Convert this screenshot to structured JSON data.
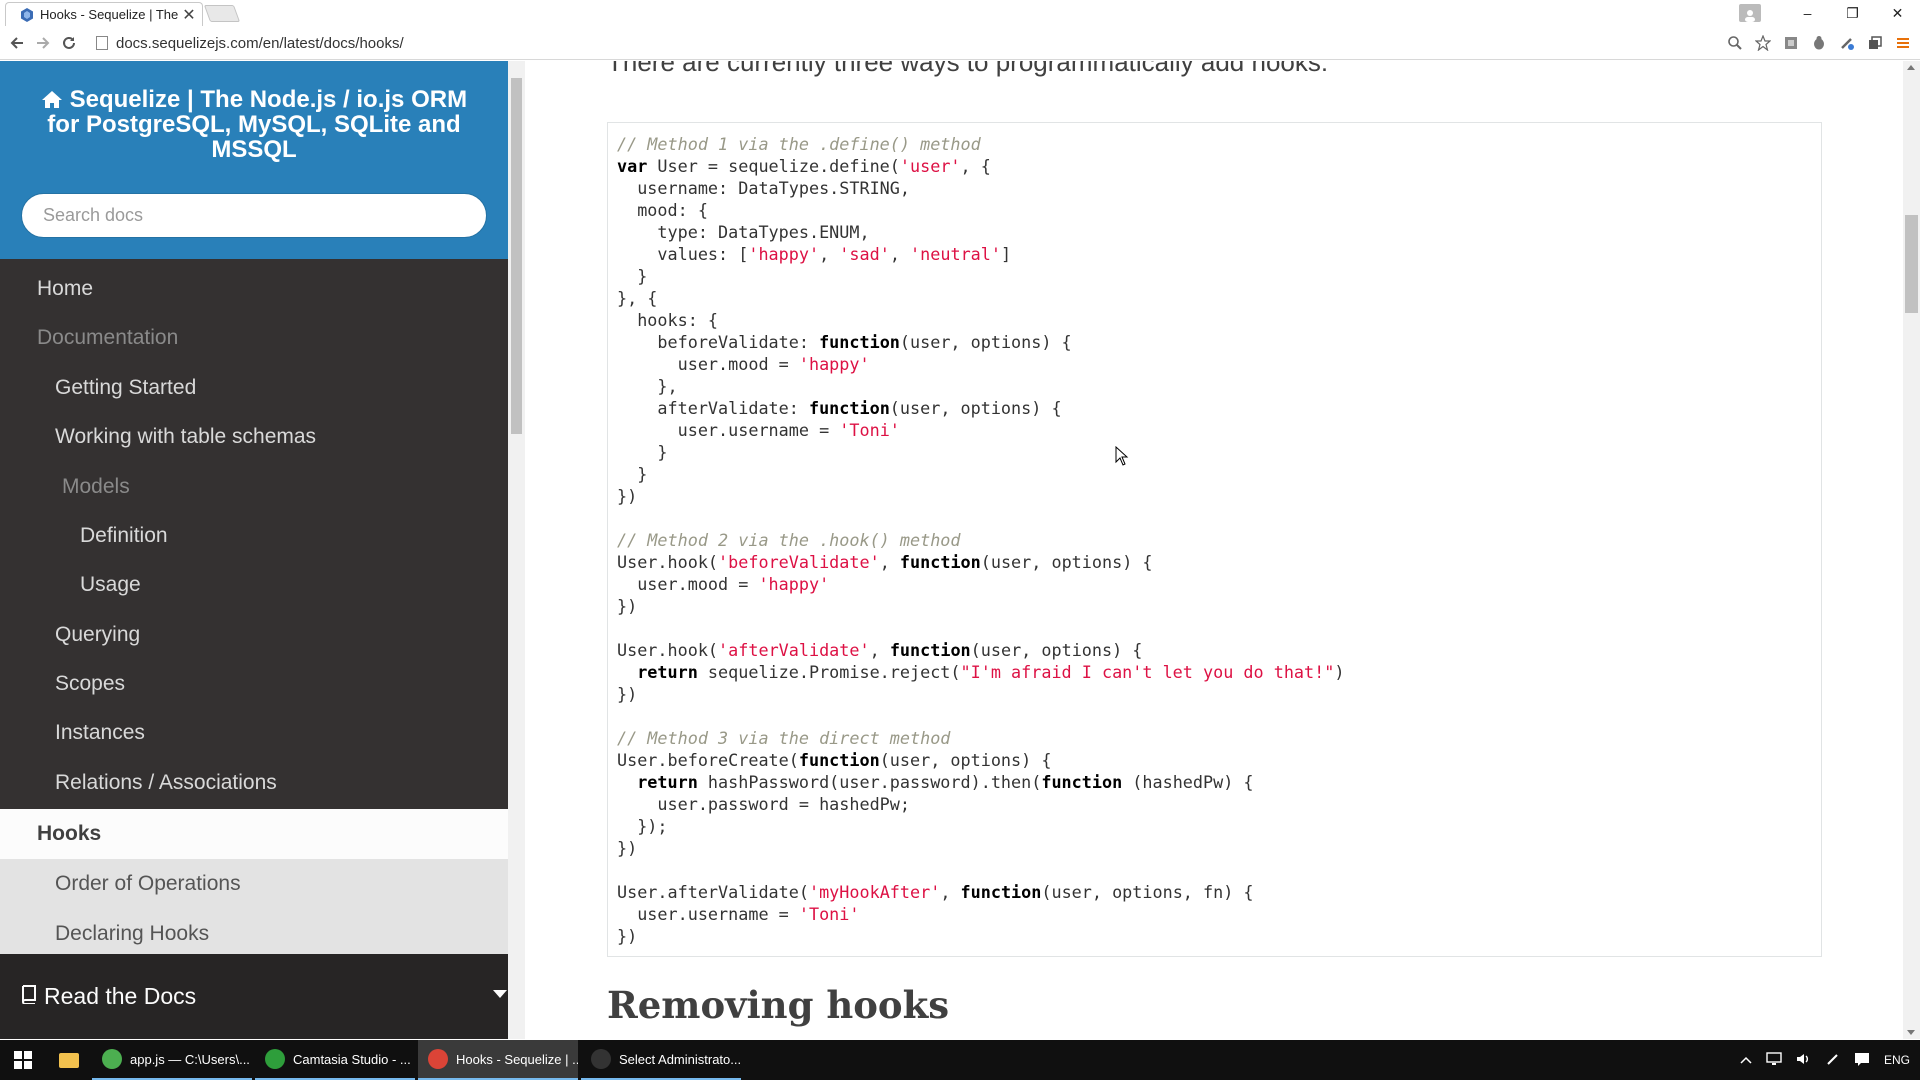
{
  "browser": {
    "tab_title": "Hooks - Sequelize | The N",
    "tab_close": "✕",
    "url": "docs.sequelizejs.com/en/latest/docs/hooks/",
    "window_controls": {
      "minimize": "–",
      "restore": "❐",
      "close": "✕"
    }
  },
  "sidebar": {
    "title": "Sequelize | The Node.js / io.js ORM for PostgreSQL, MySQL, SQLite and MSSQL",
    "search_placeholder": "Search docs",
    "items": [
      {
        "label": "Home"
      },
      {
        "label": "Documentation"
      },
      {
        "label": "Getting Started"
      },
      {
        "label": "Working with table schemas"
      },
      {
        "label": "Models"
      },
      {
        "label": "Definition"
      },
      {
        "label": "Usage"
      },
      {
        "label": "Querying"
      },
      {
        "label": "Scopes"
      },
      {
        "label": "Instances"
      },
      {
        "label": "Relations / Associations"
      },
      {
        "label": "Hooks"
      },
      {
        "label": "Order of Operations"
      },
      {
        "label": "Declaring Hooks"
      }
    ],
    "read_the_docs": "Read the Docs"
  },
  "content": {
    "intro_text": "There are currently three ways to programmatically add hooks:",
    "code_lines": [
      [
        [
          "c",
          "// Method 1 via the .define() method"
        ]
      ],
      [
        [
          "k",
          "var"
        ],
        [
          "t",
          " User = sequelize.define("
        ],
        [
          "s",
          "'user'"
        ],
        [
          "t",
          ", {"
        ]
      ],
      [
        [
          "t",
          "  username: DataTypes.STRING,"
        ]
      ],
      [
        [
          "t",
          "  mood: {"
        ]
      ],
      [
        [
          "t",
          "    type: DataTypes.ENUM,"
        ]
      ],
      [
        [
          "t",
          "    values: ["
        ],
        [
          "s",
          "'happy'"
        ],
        [
          "t",
          ", "
        ],
        [
          "s",
          "'sad'"
        ],
        [
          "t",
          ", "
        ],
        [
          "s",
          "'neutral'"
        ],
        [
          "t",
          "]"
        ]
      ],
      [
        [
          "t",
          "  }"
        ]
      ],
      [
        [
          "t",
          "}, {"
        ]
      ],
      [
        [
          "t",
          "  hooks: {"
        ]
      ],
      [
        [
          "t",
          "    beforeValidate: "
        ],
        [
          "k",
          "function"
        ],
        [
          "t",
          "(user, options) {"
        ]
      ],
      [
        [
          "t",
          "      user.mood = "
        ],
        [
          "s",
          "'happy'"
        ]
      ],
      [
        [
          "t",
          "    },"
        ]
      ],
      [
        [
          "t",
          "    afterValidate: "
        ],
        [
          "k",
          "function"
        ],
        [
          "t",
          "(user, options) {"
        ]
      ],
      [
        [
          "t",
          "      user.username = "
        ],
        [
          "s",
          "'Toni'"
        ]
      ],
      [
        [
          "t",
          "    }"
        ]
      ],
      [
        [
          "t",
          "  }"
        ]
      ],
      [
        [
          "t",
          "})"
        ]
      ],
      [
        [
          "t",
          ""
        ]
      ],
      [
        [
          "c",
          "// Method 2 via the .hook() method"
        ]
      ],
      [
        [
          "t",
          "User.hook("
        ],
        [
          "s",
          "'beforeValidate'"
        ],
        [
          "t",
          ", "
        ],
        [
          "k",
          "function"
        ],
        [
          "t",
          "(user, options) {"
        ]
      ],
      [
        [
          "t",
          "  user.mood = "
        ],
        [
          "s",
          "'happy'"
        ]
      ],
      [
        [
          "t",
          "})"
        ]
      ],
      [
        [
          "t",
          ""
        ]
      ],
      [
        [
          "t",
          "User.hook("
        ],
        [
          "s",
          "'afterValidate'"
        ],
        [
          "t",
          ", "
        ],
        [
          "k",
          "function"
        ],
        [
          "t",
          "(user, options) {"
        ]
      ],
      [
        [
          "k",
          "  return"
        ],
        [
          "t",
          " sequelize.Promise.reject("
        ],
        [
          "s",
          "\"I'm afraid I can't let you do that!\""
        ],
        [
          "t",
          ")"
        ]
      ],
      [
        [
          "t",
          "})"
        ]
      ],
      [
        [
          "t",
          ""
        ]
      ],
      [
        [
          "c",
          "// Method 3 via the direct method"
        ]
      ],
      [
        [
          "t",
          "User.beforeCreate("
        ],
        [
          "k",
          "function"
        ],
        [
          "t",
          "(user, options) {"
        ]
      ],
      [
        [
          "k",
          "  return"
        ],
        [
          "t",
          " hashPassword(user.password).then("
        ],
        [
          "k",
          "function"
        ],
        [
          "t",
          " (hashedPw) {"
        ]
      ],
      [
        [
          "t",
          "    user.password = hashedPw;"
        ]
      ],
      [
        [
          "t",
          "  });"
        ]
      ],
      [
        [
          "t",
          "})"
        ]
      ],
      [
        [
          "t",
          ""
        ]
      ],
      [
        [
          "t",
          "User.afterValidate("
        ],
        [
          "s",
          "'myHookAfter'"
        ],
        [
          "t",
          ", "
        ],
        [
          "k",
          "function"
        ],
        [
          "t",
          "(user, options, fn) {"
        ]
      ],
      [
        [
          "t",
          "  user.username = "
        ],
        [
          "s",
          "'Toni'"
        ]
      ],
      [
        [
          "t",
          "})"
        ]
      ]
    ],
    "heading_removing": "Removing hooks"
  },
  "taskbar": {
    "apps": [
      {
        "label": "app.js — C:\\Users\\...",
        "color": "#4caf50"
      },
      {
        "label": "Camtasia Studio - ...",
        "color": "#2e9e3b"
      },
      {
        "label": "Hooks - Sequelize | ...",
        "color": "#db4437"
      },
      {
        "label": "Select Administrato...",
        "color": "#333333"
      }
    ],
    "language": "ENG"
  },
  "colors": {
    "sidebar_header": "#2980b9",
    "sidebar_bg": "#343131",
    "code_keyword": "#000000",
    "code_string": "#dd1144",
    "code_comment": "#999988"
  }
}
